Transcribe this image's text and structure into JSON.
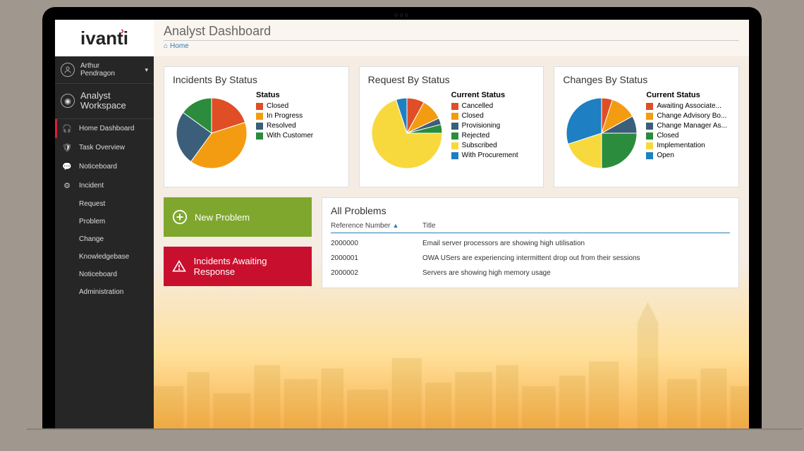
{
  "logo": "ivanti",
  "page_title": "Analyst Dashboard",
  "breadcrumb": "Home",
  "user": {
    "name_line1": "Arthur",
    "name_line2": "Pendragon"
  },
  "workspace": {
    "line1": "Analyst",
    "line2": "Workspace"
  },
  "nav": [
    {
      "label": "Home Dashboard",
      "icon": "headset",
      "active": true
    },
    {
      "label": "Task Overview",
      "icon": "shield"
    },
    {
      "label": "Noticeboard",
      "icon": "chat"
    },
    {
      "label": "Incident",
      "icon": "gear"
    },
    {
      "label": "Request",
      "icon": ""
    },
    {
      "label": "Problem",
      "icon": ""
    },
    {
      "label": "Change",
      "icon": ""
    },
    {
      "label": "Knowledgebase",
      "icon": ""
    },
    {
      "label": "Noticeboard",
      "icon": ""
    },
    {
      "label": "Administration",
      "icon": ""
    }
  ],
  "charts": {
    "incidents": {
      "title": "Incidents By Status",
      "legend_title": "Status",
      "items": [
        {
          "label": "Closed",
          "color": "#e04e26"
        },
        {
          "label": "In Progress",
          "color": "#f39c12"
        },
        {
          "label": "Resolved",
          "color": "#3b5f7a"
        },
        {
          "label": "With Customer",
          "color": "#2a8c3c"
        }
      ]
    },
    "requests": {
      "title": "Request By Status",
      "legend_title": "Current Status",
      "items": [
        {
          "label": "Cancelled",
          "color": "#e04e26"
        },
        {
          "label": "Closed",
          "color": "#f39c12"
        },
        {
          "label": "Provisioning",
          "color": "#3b5f7a"
        },
        {
          "label": "Rejected",
          "color": "#2a8c3c"
        },
        {
          "label": "Subscribed",
          "color": "#f7d93e"
        },
        {
          "label": "With Procurement",
          "color": "#1e7fc2"
        }
      ]
    },
    "changes": {
      "title": "Changes By Status",
      "legend_title": "Current Status",
      "items": [
        {
          "label": "Awaiting Associate...",
          "color": "#e04e26"
        },
        {
          "label": "Change Advisory Bo...",
          "color": "#f39c12"
        },
        {
          "label": "Change Manager As...",
          "color": "#3b5f7a"
        },
        {
          "label": "Closed",
          "color": "#2a8c3c"
        },
        {
          "label": "Implementation",
          "color": "#f7d93e"
        },
        {
          "label": "Open",
          "color": "#1e7fc2"
        }
      ]
    }
  },
  "actions": {
    "new_problem": "New Problem",
    "awaiting_response": "Incidents Awaiting Response"
  },
  "problems": {
    "title": "All Problems",
    "col_ref": "Reference Number",
    "col_title": "Title",
    "rows": [
      {
        "ref": "2000000",
        "title": "Email server processors are showing high utilisation"
      },
      {
        "ref": "2000001",
        "title": "OWA USers are experiencing intermittent drop out from their sessions"
      },
      {
        "ref": "2000002",
        "title": "Servers are showing high memory usage"
      }
    ]
  },
  "chart_data": [
    {
      "type": "pie",
      "title": "Incidents By Status",
      "series": [
        {
          "name": "Status",
          "values": [
            {
              "name": "Closed",
              "value": 20
            },
            {
              "name": "In Progress",
              "value": 40
            },
            {
              "name": "Resolved",
              "value": 25
            },
            {
              "name": "With Customer",
              "value": 15
            }
          ]
        }
      ]
    },
    {
      "type": "pie",
      "title": "Request By Status",
      "series": [
        {
          "name": "Current Status",
          "values": [
            {
              "name": "Cancelled",
              "value": 8
            },
            {
              "name": "Closed",
              "value": 10
            },
            {
              "name": "Provisioning",
              "value": 3
            },
            {
              "name": "Rejected",
              "value": 4
            },
            {
              "name": "Subscribed",
              "value": 70
            },
            {
              "name": "With Procurement",
              "value": 5
            }
          ]
        }
      ]
    },
    {
      "type": "pie",
      "title": "Changes By Status",
      "series": [
        {
          "name": "Current Status",
          "values": [
            {
              "name": "Awaiting Associate...",
              "value": 5
            },
            {
              "name": "Change Advisory Bo...",
              "value": 12
            },
            {
              "name": "Change Manager As...",
              "value": 8
            },
            {
              "name": "Closed",
              "value": 25
            },
            {
              "name": "Implementation",
              "value": 20
            },
            {
              "name": "Open",
              "value": 30
            }
          ]
        }
      ]
    }
  ]
}
